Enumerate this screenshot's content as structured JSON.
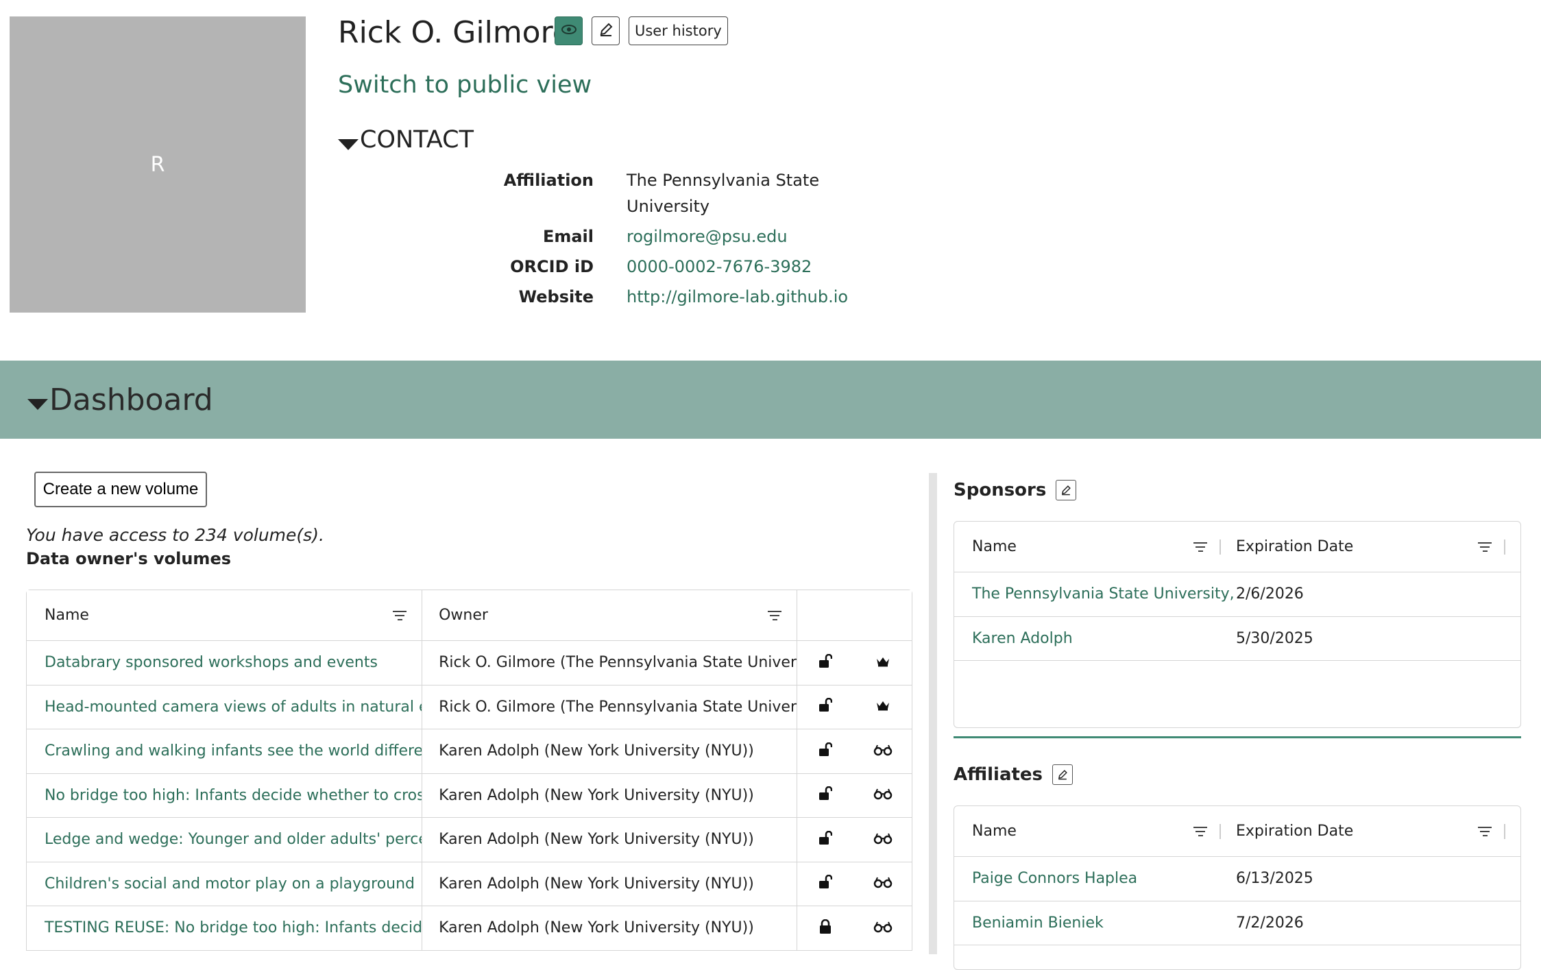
{
  "profile": {
    "avatar_initial": "R",
    "name": "Rick O. Gilmore",
    "user_history_label": "User history",
    "switch_view_label": "Switch to public view"
  },
  "contact": {
    "heading": "CONTACT",
    "affiliation_label": "Affiliation",
    "affiliation_line1": "The Pennsylvania State",
    "affiliation_line2": "University",
    "email_label": "Email",
    "email": "rogilmore@psu.edu",
    "orcid_label": "ORCID iD",
    "orcid": "0000-0002-7676-3982",
    "website_label": "Website",
    "website": "http://gilmore-lab.github.io"
  },
  "dashboard": {
    "title": "Dashboard",
    "create_label": "Create a new volume",
    "access_text": "You have access to 234 volume(s).",
    "owner_title": "Data owner's volumes",
    "columns": [
      "Name",
      "Owner"
    ],
    "volumes": [
      {
        "name": "Databrary sponsored workshops and events",
        "owner": "Rick O. Gilmore (The Pennsylvania State Univer...",
        "lock": "unlocked",
        "role": "crown"
      },
      {
        "name": "Head-mounted camera views of adults in natural environments",
        "owner": "Rick O. Gilmore (The Pennsylvania State Univer...",
        "lock": "unlocked",
        "role": "crown"
      },
      {
        "name": "Crawling and walking infants see the world differently",
        "owner": "Karen Adolph (New York University (NYU))",
        "lock": "unlocked",
        "role": "glasses"
      },
      {
        "name": "No bridge too high: Infants decide whether to cross based on the probability of falling",
        "owner": "Karen Adolph (New York University (NYU))",
        "lock": "unlocked",
        "role": "glasses"
      },
      {
        "name": "Ledge and wedge: Younger and older adults' perception of action possibilities",
        "owner": "Karen Adolph (New York University (NYU))",
        "lock": "unlocked",
        "role": "glasses"
      },
      {
        "name": "Children's social and motor play on a playground",
        "owner": "Karen Adolph (New York University (NYU))",
        "lock": "unlocked",
        "role": "glasses"
      },
      {
        "name": "TESTING REUSE: No bridge too high: Infants decide whether to cross",
        "owner": "Karen Adolph (New York University (NYU))",
        "lock": "locked",
        "role": "glasses"
      }
    ]
  },
  "sponsors": {
    "title": "Sponsors",
    "columns": [
      "Name",
      "Expiration Date"
    ],
    "rows": [
      {
        "name": "The Pennsylvania State University, University Park",
        "date": "2/6/2026"
      },
      {
        "name": "Karen Adolph",
        "date": "5/30/2025"
      }
    ]
  },
  "affiliates": {
    "title": "Affiliates",
    "columns": [
      "Name",
      "Expiration Date"
    ],
    "rows": [
      {
        "name": "Paige Connors Haplea",
        "date": "6/13/2025"
      },
      {
        "name": "Beniamin Bieniek",
        "date": "7/2/2026"
      }
    ]
  },
  "colors": {
    "accent": "#2c6e59",
    "dashboard_bar": "#8aaea5",
    "avatar_bg": "#b4b4b4"
  }
}
